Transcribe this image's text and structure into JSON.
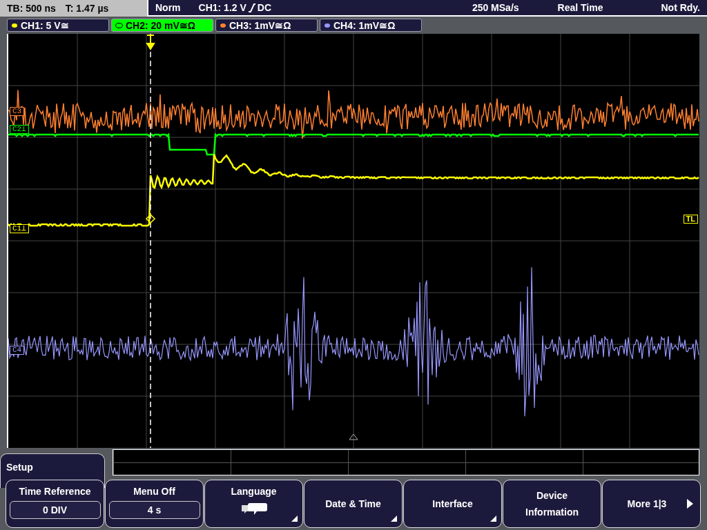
{
  "status_bar": {
    "timebase": "TB: 500 ns",
    "trigger_time": "T: 1.47 µs",
    "trigger_mode": "Norm",
    "trigger_source": "CH1: 1.2 V",
    "coupling": "DC",
    "sample_rate": "250 MSa/s",
    "acquisition": "Real Time",
    "trigger_state": "Not Rdy."
  },
  "channels": [
    {
      "label": "CH1: 5 V≅",
      "color": "#ffff00",
      "selected": false
    },
    {
      "label": "CH2: 20 mV≅Ω",
      "color": "#00ff00",
      "selected": true
    },
    {
      "label": "CH3: 1mV≅Ω",
      "color": "#ff8030",
      "selected": false
    },
    {
      "label": "CH4: 1mV≅Ω",
      "color": "#9898ff",
      "selected": false
    }
  ],
  "display": {
    "channel_markers": [
      {
        "label": "C3",
        "color": "#ff8030"
      },
      {
        "label": "C2⊥",
        "color": "#00ff00"
      },
      {
        "label": "C1⊥",
        "color": "#ffff00"
      },
      {
        "label": "C4",
        "color": "#9898ff"
      }
    ],
    "trigger_level_marker": "TL"
  },
  "menu": {
    "title": "Setup",
    "softkeys": [
      {
        "kind": "value",
        "label": "Time Reference",
        "value": "0 DIV",
        "submenu": false
      },
      {
        "kind": "value",
        "label": "Menu Off",
        "value": "4 s",
        "submenu": false
      },
      {
        "kind": "icon",
        "label": "Language",
        "submenu": true
      },
      {
        "kind": "text",
        "label": "Date & Time",
        "submenu": true
      },
      {
        "kind": "text",
        "label": "Interface",
        "submenu": true
      },
      {
        "kind": "text",
        "label": "Device Information",
        "submenu": false
      },
      {
        "kind": "page",
        "label": "More 1|3",
        "submenu": false
      }
    ]
  }
}
